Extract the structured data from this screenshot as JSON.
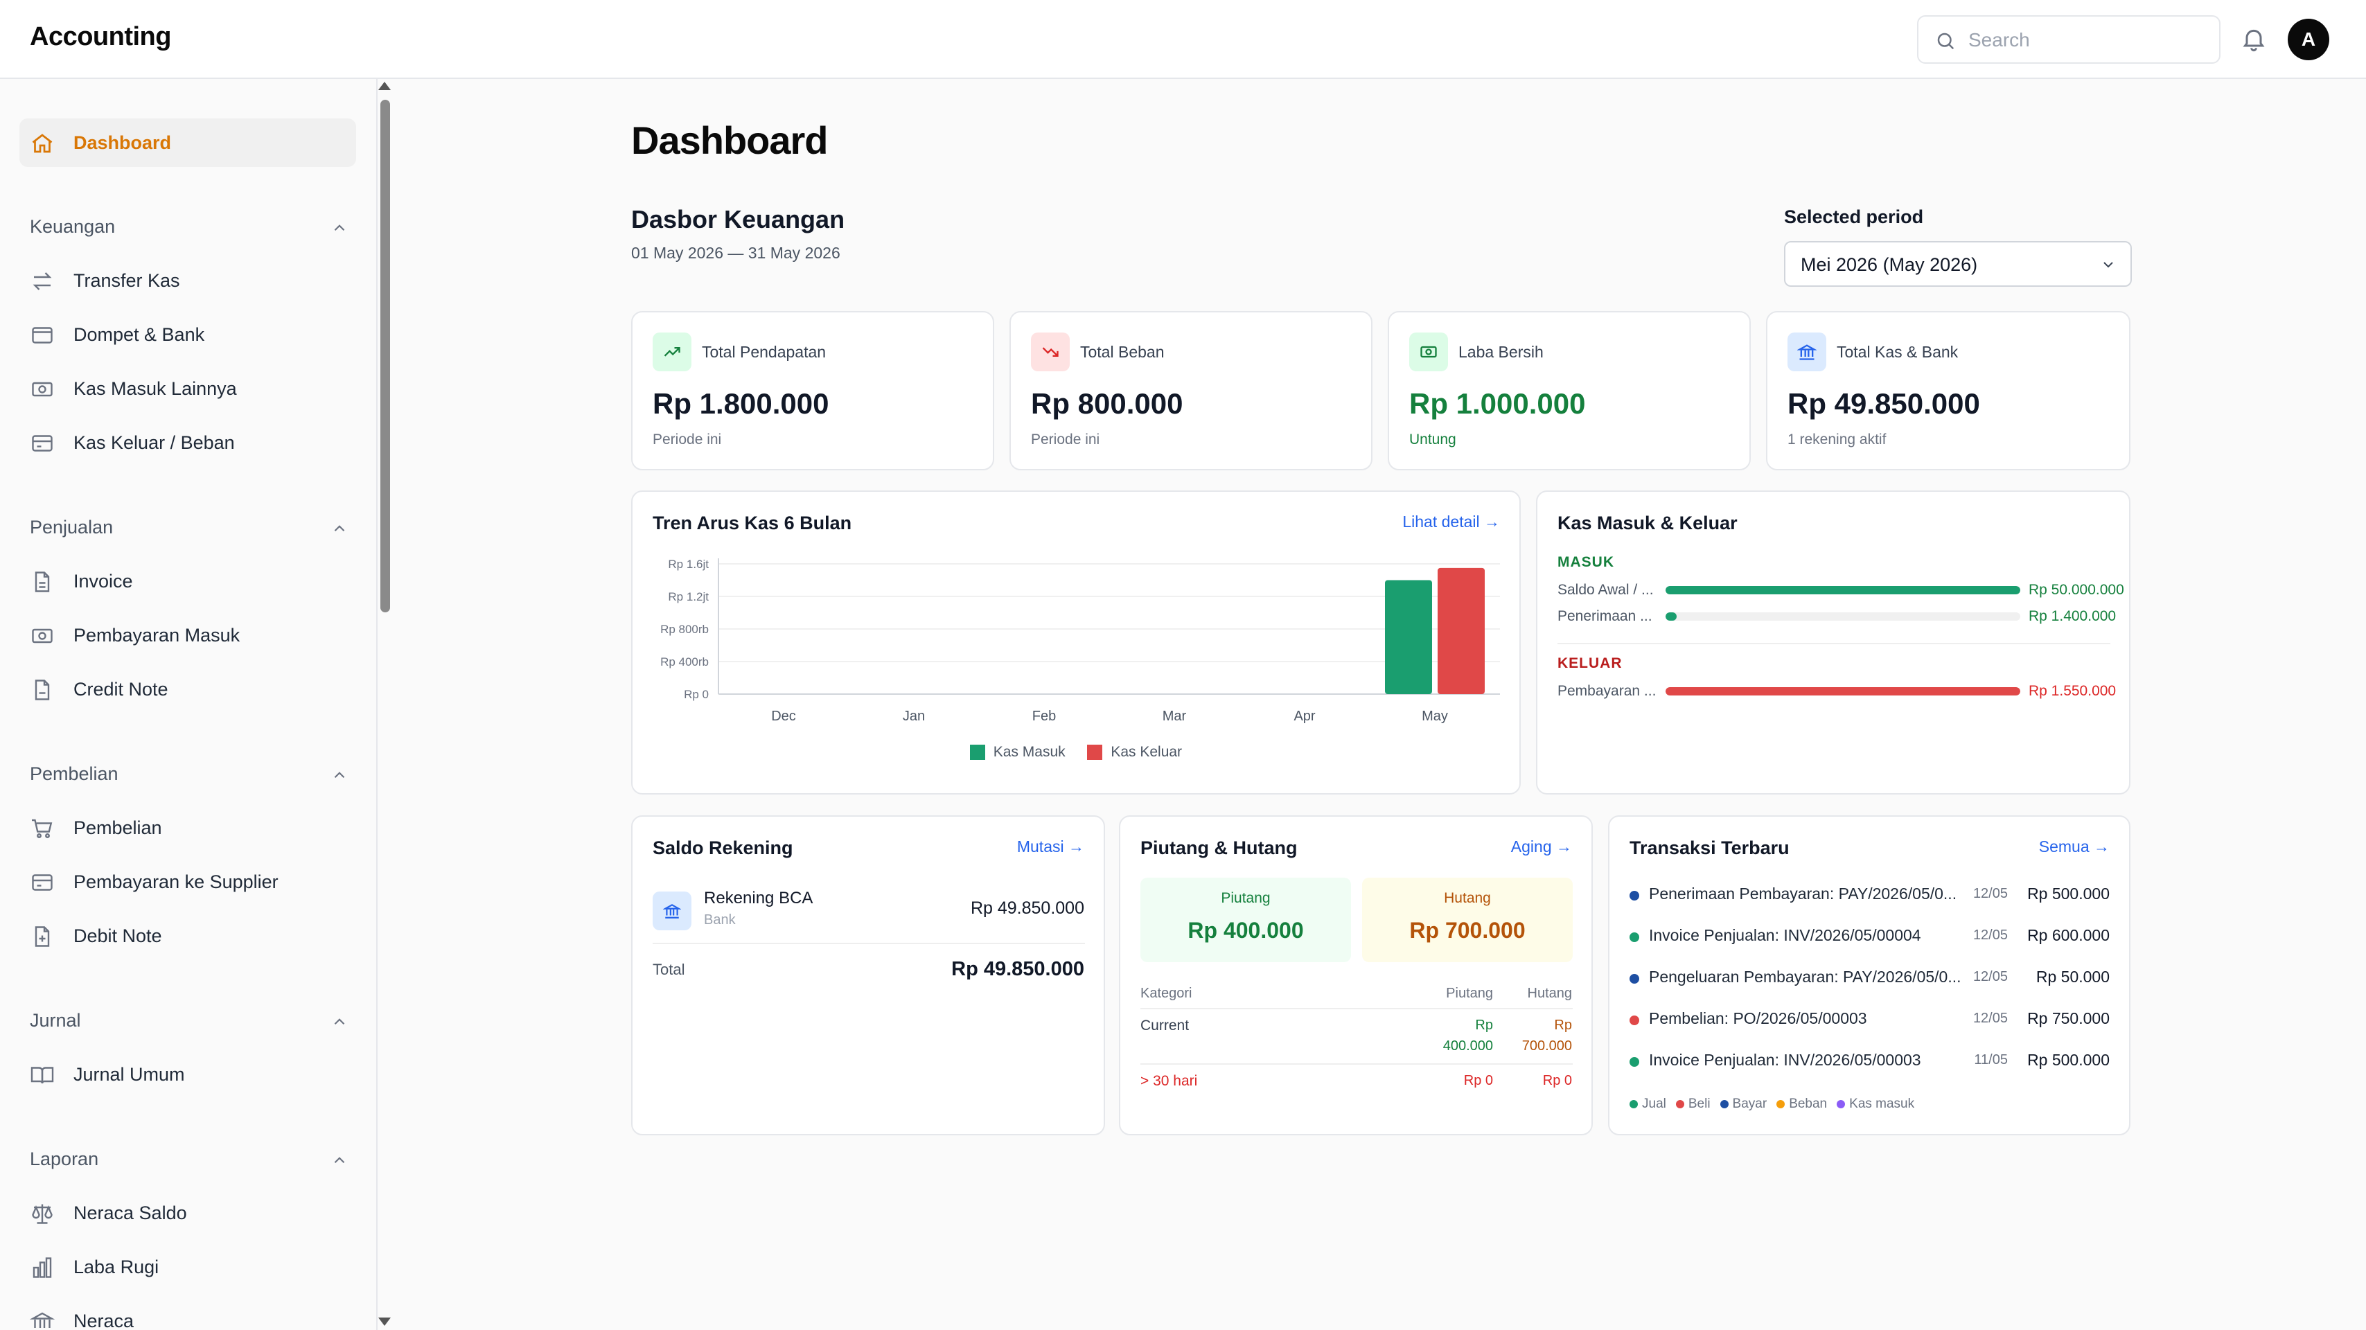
{
  "app": {
    "title": "Accounting"
  },
  "search": {
    "placeholder": "Search"
  },
  "user": {
    "initial": "A"
  },
  "sidebar": {
    "dashboard": {
      "label": "Dashboard"
    },
    "sections": {
      "keuangan": {
        "title": "Keuangan",
        "items": [
          "Transfer Kas",
          "Dompet & Bank",
          "Kas Masuk Lainnya",
          "Kas Keluar / Beban"
        ]
      },
      "penjualan": {
        "title": "Penjualan",
        "items": [
          "Invoice",
          "Pembayaran Masuk",
          "Credit Note"
        ]
      },
      "pembelian": {
        "title": "Pembelian",
        "items": [
          "Pembelian",
          "Pembayaran ke Supplier",
          "Debit Note"
        ]
      },
      "jurnal": {
        "title": "Jurnal",
        "items": [
          "Jurnal Umum"
        ]
      },
      "laporan": {
        "title": "Laporan",
        "items": [
          "Neraca Saldo",
          "Laba Rugi",
          "Neraca"
        ]
      }
    }
  },
  "main": {
    "page_title": "Dashboard",
    "subtitle": "Dasbor Keuangan",
    "date_range": "01 May 2026 — 31 May 2026",
    "period": {
      "label": "Selected period",
      "value": "Mei 2026 (May 2026)"
    }
  },
  "kpis": [
    {
      "label": "Total Pendapatan",
      "value": "Rp 1.800.000",
      "note": "Periode ini"
    },
    {
      "label": "Total Beban",
      "value": "Rp 800.000",
      "note": "Periode ini"
    },
    {
      "label": "Laba Bersih",
      "value": "Rp 1.000.000",
      "note": "Untung"
    },
    {
      "label": "Total Kas & Bank",
      "value": "Rp 49.850.000",
      "note": "1 rekening aktif"
    }
  ],
  "trend": {
    "title": "Tren Arus Kas 6 Bulan",
    "link": "Lihat detail →"
  },
  "chart_data": {
    "type": "bar",
    "title": "Tren Arus Kas 6 Bulan",
    "categories": [
      "Dec",
      "Jan",
      "Feb",
      "Mar",
      "Apr",
      "May"
    ],
    "series": [
      {
        "name": "Kas Masuk",
        "values": [
          0,
          0,
          0,
          0,
          0,
          1400000
        ]
      },
      {
        "name": "Kas Keluar",
        "values": [
          0,
          0,
          0,
          0,
          0,
          1550000
        ]
      }
    ],
    "y_ticks": [
      "Rp 0",
      "Rp 400rb",
      "Rp 800rb",
      "Rp 1.2jt",
      "Rp 1.6jt"
    ],
    "ylim": [
      0,
      1600000
    ],
    "colors": [
      "#1a9e6f",
      "#e04848"
    ],
    "legend": "bottom-center",
    "grid": true
  },
  "flow": {
    "title": "Kas Masuk & Keluar",
    "masuk_title": "MASUK",
    "keluar_title": "KELUAR",
    "masuk": [
      {
        "label": "Saldo Awal / ...",
        "value": "Rp 50.000.000",
        "fraction": 1.0
      },
      {
        "label": "Penerimaan ...",
        "value": "Rp 1.400.000",
        "fraction": 0.028
      }
    ],
    "keluar": [
      {
        "label": "Pembayaran ...",
        "value": "Rp 1.550.000",
        "fraction": 1.0
      }
    ]
  },
  "saldo": {
    "title": "Saldo Rekening",
    "link": "Mutasi →",
    "account": {
      "name": "Rekening BCA",
      "type": "Bank",
      "amount": "Rp 49.850.000"
    },
    "total_label": "Total",
    "total_value": "Rp 49.850.000"
  },
  "piutang": {
    "title": "Piutang & Hutang",
    "link": "Aging →",
    "piutang_label": "Piutang",
    "piutang_value": "Rp 400.000",
    "hutang_label": "Hutang",
    "hutang_value": "Rp 700.000",
    "headers": {
      "kategori": "Kategori",
      "piutang": "Piutang",
      "hutang": "Hutang"
    },
    "rows": [
      {
        "kategori": "Current",
        "piutang_1": "Rp",
        "piutang_2": "400.000",
        "hutang_1": "Rp",
        "hutang_2": "700.000"
      },
      {
        "kategori": "> 30 hari",
        "piutang": "Rp 0",
        "hutang": "Rp 0"
      }
    ]
  },
  "transaksi": {
    "title": "Transaksi Terbaru",
    "link": "Semua →",
    "items": [
      {
        "desc": "Penerimaan Pembayaran: PAY/2026/05/0...",
        "date": "12/05",
        "amount": "Rp 500.000",
        "color": "#1e4fa3"
      },
      {
        "desc": "Invoice Penjualan: INV/2026/05/00004",
        "date": "12/05",
        "amount": "Rp 600.000",
        "color": "#1a9e6f"
      },
      {
        "desc": "Pengeluaran Pembayaran: PAY/2026/05/0...",
        "date": "12/05",
        "amount": "Rp 50.000",
        "color": "#1e4fa3"
      },
      {
        "desc": "Pembelian: PO/2026/05/00003",
        "date": "12/05",
        "amount": "Rp 750.000",
        "color": "#e04848"
      },
      {
        "desc": "Invoice Penjualan: INV/2026/05/00003",
        "date": "11/05",
        "amount": "Rp 500.000",
        "color": "#1a9e6f"
      }
    ],
    "legend": [
      {
        "label": "Jual",
        "color": "#1a9e6f"
      },
      {
        "label": "Beli",
        "color": "#e04848"
      },
      {
        "label": "Bayar",
        "color": "#1e4fa3"
      },
      {
        "label": "Beban",
        "color": "#f59e0b"
      },
      {
        "label": "Kas masuk",
        "color": "#8b5cf6"
      }
    ]
  },
  "colors": {
    "accent": "#d97706",
    "link": "#2563eb",
    "positive": "#15803d",
    "negative": "#dc2626"
  }
}
